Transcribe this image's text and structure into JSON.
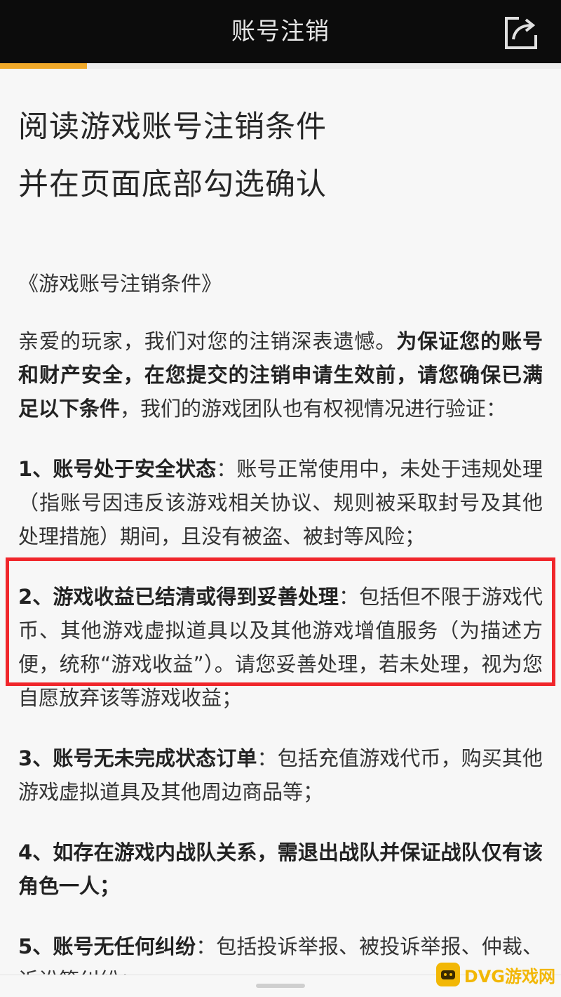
{
  "header": {
    "title": "账号注销",
    "share_icon": "share-icon",
    "progress_percent": 15.5,
    "accent_color": "#f0a92a"
  },
  "page": {
    "title_line1": "阅读游戏账号注销条件",
    "title_line2": "并在页面底部勾选确认",
    "doc_name": "《游戏账号注销条件》"
  },
  "intro": {
    "text1": "亲爱的玩家，我们对您的注销深表遗憾。",
    "text2_bold": "为保证您的账号和财产安全，在您提交的注销申请生效前，请您确保已满足以下条件",
    "text3": "，我们的游戏团队也有权视情况进行验证："
  },
  "conditions": [
    {
      "bold": "1、账号处于安全状态",
      "text": "：账号正常使用中，未处于违规处理（指账号因违反该游戏相关协议、规则被采取封号及其他处理措施）期间，且没有被盗、被封等风险；"
    },
    {
      "bold": "2、游戏收益已结清或得到妥善处理",
      "text": "：包括但不限于游戏代币、其他游戏虚拟道具以及其他游戏增值服务（为描述方便，统称“游戏收益”）。请您妥善处理，若未处理，视为您自愿放弃该等游戏收益；"
    },
    {
      "bold": "3、账号无未完成状态订单",
      "text": "：包括充值游戏代币，购买其他游戏虚拟道具及其他周边商品等；"
    },
    {
      "bold": "4、如存在游戏内战队关系，需退出战队并保证战队仅有该角色一人；",
      "text": ""
    },
    {
      "bold": "5、账号无任何纠纷",
      "text": "：包括投诉举报、被投诉举报、仲裁、诉讼等纠纷；"
    }
  ],
  "highlight": {
    "color": "#f0262b"
  },
  "watermark": {
    "text": "DVG游戏网",
    "color": "#f2b705"
  }
}
